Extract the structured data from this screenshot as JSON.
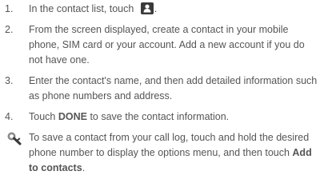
{
  "steps": [
    {
      "number": "1.",
      "text_before": "In the contact list, touch",
      "text_after": ".",
      "icon": "add-contact-icon"
    },
    {
      "number": "2.",
      "text": "From the screen displayed, create a contact in your mobile phone, SIM card or your account. Add a new account if you do not have one."
    },
    {
      "number": "3.",
      "text": "Enter the contact's name, and then add detailed information such as phone numbers and address."
    },
    {
      "number": "4.",
      "text_before": "Touch",
      "bold": "DONE",
      "text_after": "to save the contact information."
    }
  ],
  "note": {
    "icon": "tip-icon",
    "text": "To save a contact from your call log, touch and hold the desired phone number to display the options menu, and then touch",
    "bold": "Add to contacts",
    "text_after": "."
  },
  "colors": {
    "text": "#555555",
    "icon_dark": "#3a3a3a",
    "icon_accent": "#8a8a8a"
  }
}
